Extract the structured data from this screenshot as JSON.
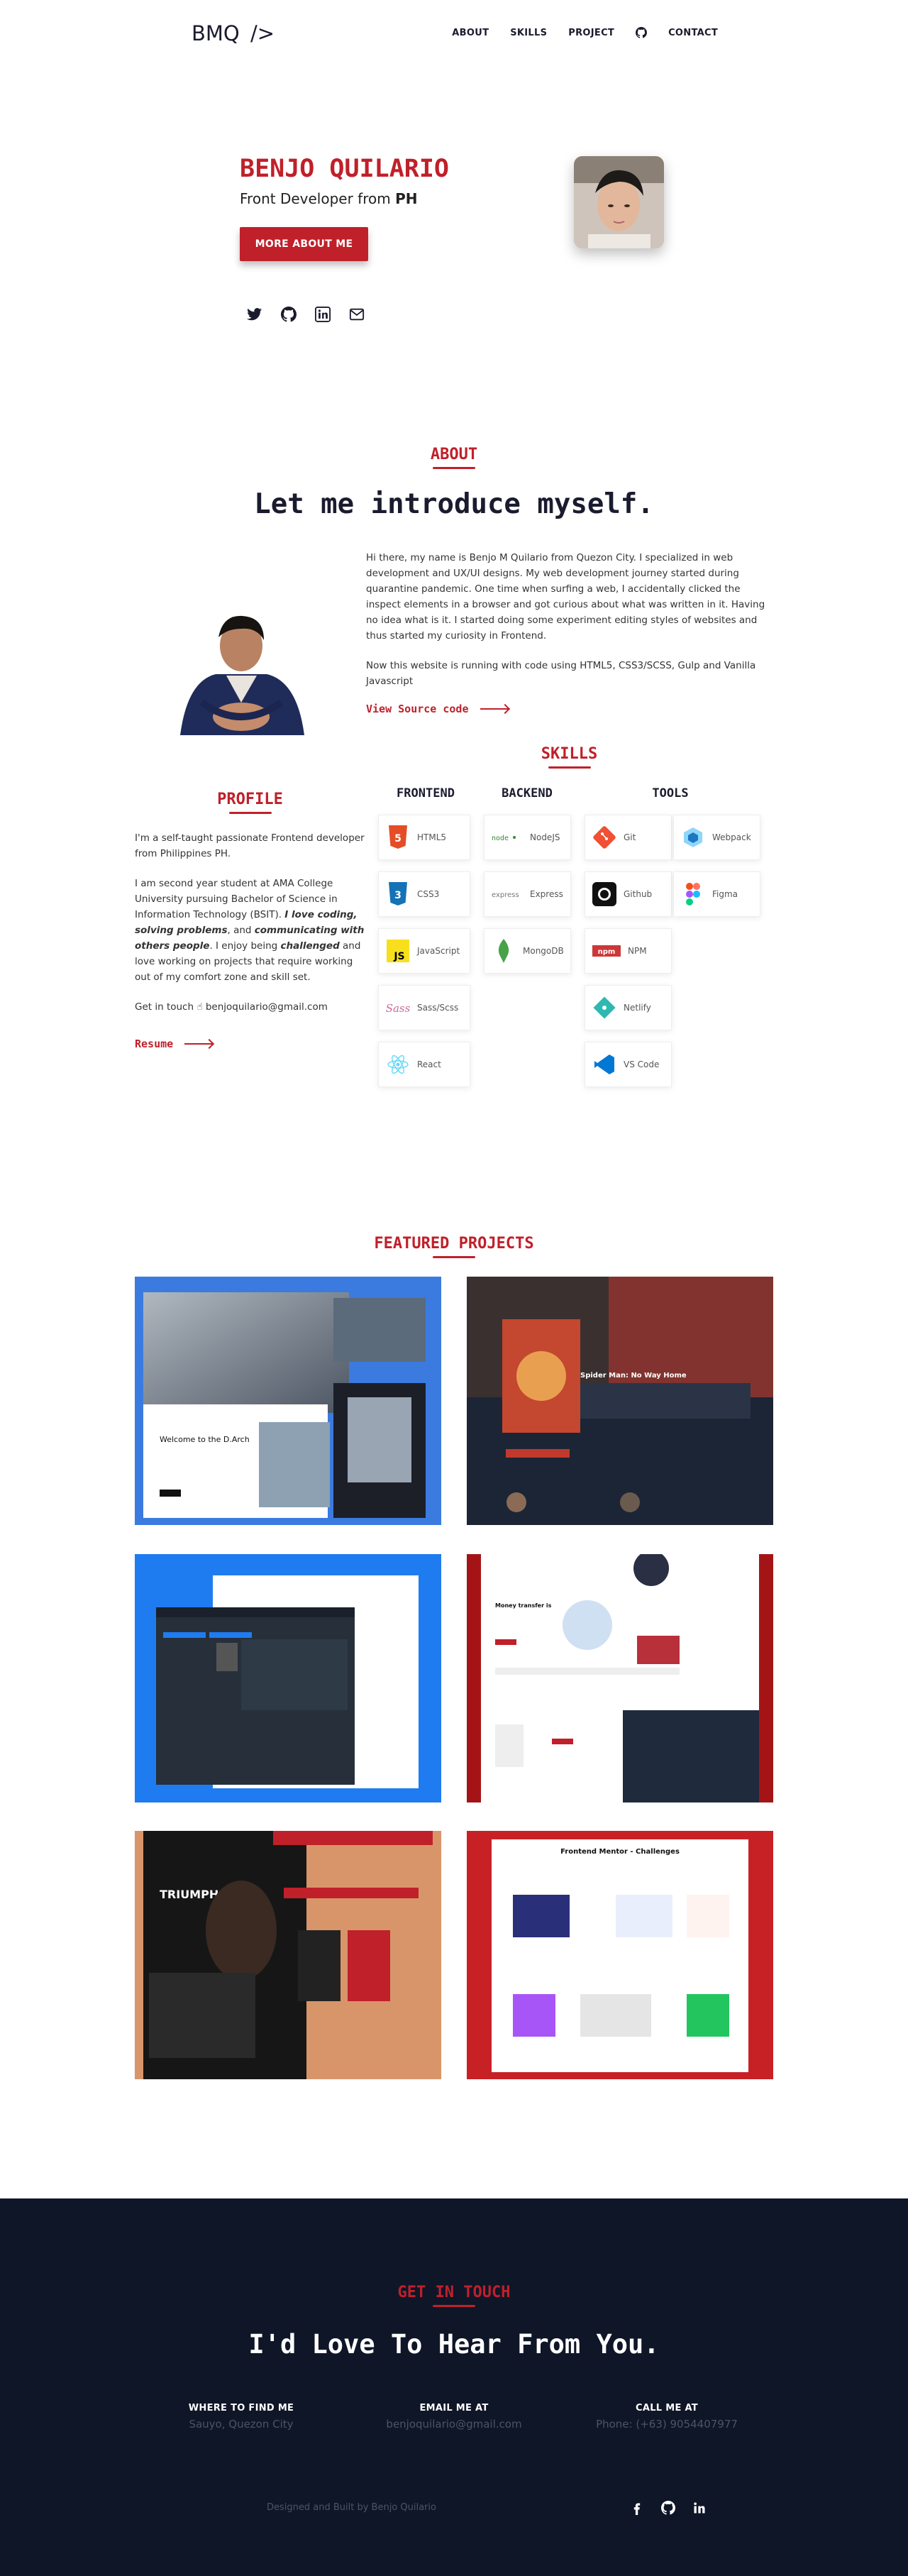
{
  "nav": {
    "logo_main": "BMQ",
    "logo_slash": "/>",
    "links": [
      "ABOUT",
      "SKILLS",
      "PROJECT",
      "CONTACT"
    ],
    "github_icon": "github-icon"
  },
  "hero": {
    "name": "BENJO QUILARIO",
    "subtitle_prefix": "Front Developer from ",
    "subtitle_bold": "PH",
    "button": "MORE ABOUT ME",
    "socials": [
      "twitter-icon",
      "github-icon",
      "linkedin-icon",
      "mail-icon"
    ]
  },
  "about": {
    "label": "ABOUT",
    "title": "Let me introduce myself.",
    "p1": "Hi there, my name is Benjo M Quilario from Quezon City. I specialized in web development and UX/UI designs. My web development journey started during quarantine pandemic. One time when surfing a web, I accidentally clicked the inspect elements in a browser and got curious about what was written in it. Having no idea what is it. I started doing some experiment editing styles of websites and thus started my curiosity in Frontend.",
    "p2": "Now this website is running with code using HTML5, CSS3/SCSS, Gulp and Vanilla Javascript",
    "view_source": "View Source code"
  },
  "profile": {
    "label": "PROFILE",
    "p1": "I'm a self-taught passionate Frontend developer from Philippines PH.",
    "p2_a": "I am second year student at AMA College University pursuing Bachelor of Science in Information Technology (BSIT). ",
    "p2_b": "I love coding, solving problems",
    "p2_c": ", and ",
    "p2_d": "communicating with others people",
    "p2_e": ". I enjoy being ",
    "p2_f": "challenged",
    "p2_g": " and love working on projects that require working out of my comfort zone and skill set.",
    "touch_prefix": "Get in touch ",
    "touch_email": "benjoquilario@gmail.com",
    "resume": "Resume"
  },
  "skills": {
    "label": "SKILLS",
    "frontend_head": "FRONTEND",
    "backend_head": "BACKEND",
    "tools_head": "TOOLS",
    "frontend": [
      "HTML5",
      "CSS3",
      "JavaScript",
      "Sass/Scss",
      "React"
    ],
    "backend": [
      "NodeJS",
      "Express",
      "MongoDB"
    ],
    "tools_a": [
      "Git",
      "Github",
      "NPM",
      "Netlify",
      "VS Code"
    ],
    "tools_b": [
      "Webpack",
      "Figma"
    ]
  },
  "projects": {
    "label": "FEATURED PROJECTS",
    "items": [
      {
        "bg": "#3b7be0"
      },
      {
        "bg": "#1c2536"
      },
      {
        "bg": "#1f7cf0"
      },
      {
        "bg": "#a41416"
      },
      {
        "bg": "#d8956a"
      },
      {
        "bg": "#c72126"
      }
    ],
    "p2_title": "Spider Man: No Way Home",
    "p6_title": "Frontend Mentor - Challenges",
    "p5_title": "TRIUMPH GYM"
  },
  "contact": {
    "label": "GET IN TOUCH",
    "title": "I'd Love To Hear From You.",
    "find_h": "WHERE TO FIND ME",
    "find_v": "Sauyo, Quezon City",
    "email_h": "EMAIL ME AT",
    "email_v": "benjoquilario@gmail.com",
    "call_h": "CALL ME AT",
    "call_v": "Phone: (+63) 9054407977",
    "credit": "Designed and Built by Benjo Quilario"
  },
  "colors": {
    "accent": "#c0202a",
    "dark": "#0f1628",
    "text": "#1b1b2f"
  }
}
